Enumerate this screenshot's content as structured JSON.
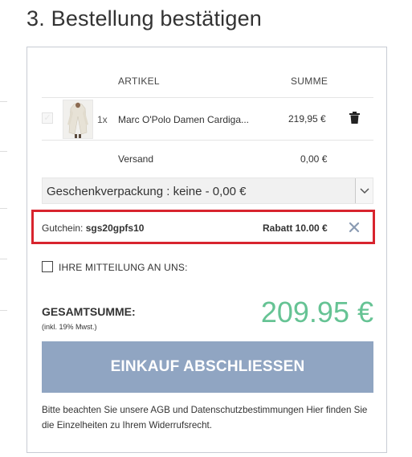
{
  "page": {
    "heading": "3. Bestellung bestätigen"
  },
  "table": {
    "col_article": "ARTIKEL",
    "col_sum": "SUMME"
  },
  "item": {
    "quantity": "1x",
    "name": "Marc O'Polo Damen Cardiga...",
    "price": "219,95 €",
    "icon": "trash-icon"
  },
  "shipping": {
    "label": "Versand",
    "price": "0,00 €"
  },
  "gift_wrap": {
    "selected": "Geschenkverpackung : keine - 0,00 €"
  },
  "coupon": {
    "label": "Gutchein:",
    "code": "sgs20gpfs10",
    "discount": "Rabatt 10.00 €",
    "highlight_color": "#d8242e"
  },
  "message": {
    "label": "IHRE MITTEILUNG AN UNS:"
  },
  "total": {
    "label": "GESAMTSUMME:",
    "tax_note": "(inkl. 19% Mwst.)",
    "amount": "209.95 €",
    "amount_color": "#66c394"
  },
  "checkout": {
    "button_label": "EINKAUF ABSCHLIESSEN",
    "button_color": "#90a5c2"
  },
  "legal": {
    "note": "Bitte beachten Sie unsere AGB und Datenschutzbestimmungen Hier finden Sie die Einzelheiten zu Ihrem Widerrufsrecht."
  }
}
